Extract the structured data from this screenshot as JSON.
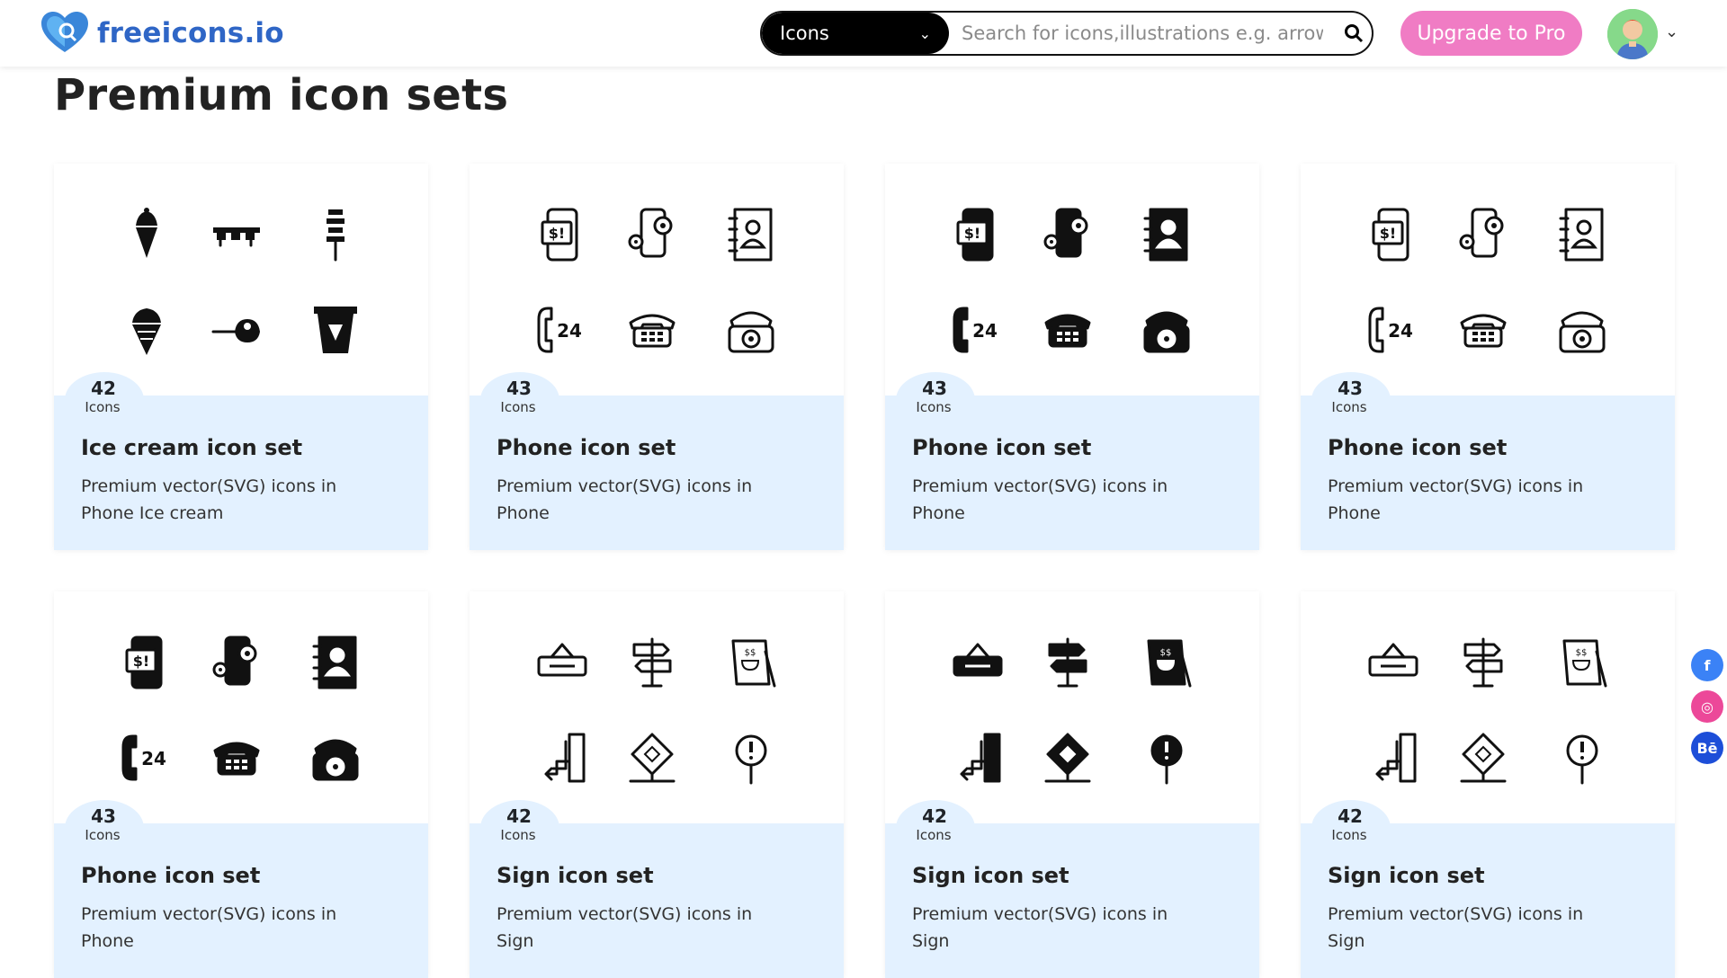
{
  "brand": {
    "name": "freeicons.io"
  },
  "search": {
    "type_label": "Icons",
    "placeholder": "Search for icons,illustrations e.g. arrow, fo"
  },
  "header": {
    "upgrade_label": "Upgrade to Pro"
  },
  "page": {
    "title": "Premium icon sets"
  },
  "cards": [
    {
      "count": "42",
      "count_label": "Icons",
      "title": "Ice cream icon set",
      "desc": "Premium vector(SVG) icons in Phone Ice cream",
      "style": "solid"
    },
    {
      "count": "43",
      "count_label": "Icons",
      "title": "Phone icon set",
      "desc": "Premium vector(SVG) icons in Phone",
      "style": "outline"
    },
    {
      "count": "43",
      "count_label": "Icons",
      "title": "Phone icon set",
      "desc": "Premium vector(SVG) icons in Phone",
      "style": "glyph"
    },
    {
      "count": "43",
      "count_label": "Icons",
      "title": "Phone icon set",
      "desc": "Premium vector(SVG) icons in Phone",
      "style": "outline"
    },
    {
      "count": "43",
      "count_label": "Icons",
      "title": "Phone icon set",
      "desc": "Premium vector(SVG) icons in Phone",
      "style": "solid"
    },
    {
      "count": "42",
      "count_label": "Icons",
      "title": "Sign icon set",
      "desc": "Premium vector(SVG) icons in Sign",
      "style": "outline"
    },
    {
      "count": "42",
      "count_label": "Icons",
      "title": "Sign icon set",
      "desc": "Premium vector(SVG) icons in Sign",
      "style": "glyph"
    },
    {
      "count": "42",
      "count_label": "Icons",
      "title": "Sign icon set",
      "desc": "Premium vector(SVG) icons in Sign",
      "style": "outline"
    }
  ],
  "social": [
    {
      "name": "facebook-icon",
      "glyph": "f",
      "color": "#3b82f6"
    },
    {
      "name": "dribbble-icon",
      "glyph": "◎",
      "color": "#ec4899"
    },
    {
      "name": "behance-icon",
      "glyph": "Bē",
      "color": "#1d4ed8"
    }
  ]
}
